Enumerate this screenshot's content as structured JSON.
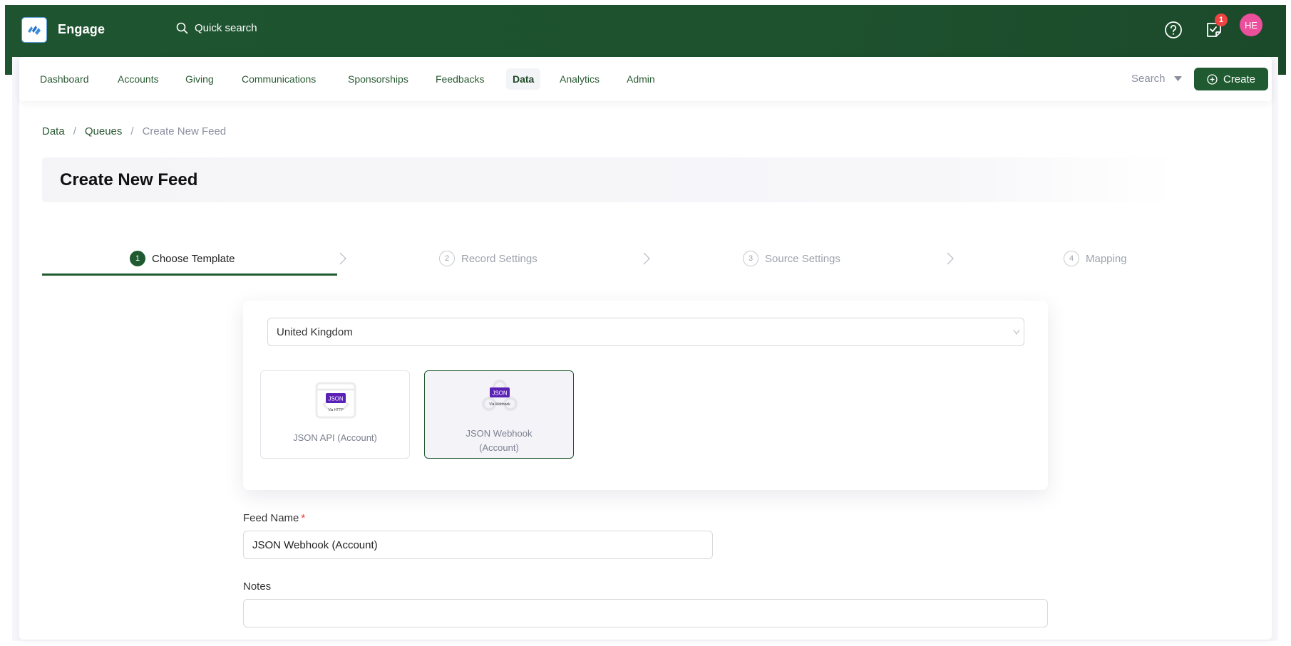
{
  "header": {
    "brand": "Engage",
    "quick_search_label": "Quick search",
    "notification_count": "1",
    "avatar_initials": "HE"
  },
  "nav": {
    "items": [
      {
        "label": "Dashboard",
        "active": false
      },
      {
        "label": "Accounts",
        "active": false
      },
      {
        "label": "Giving",
        "active": false
      },
      {
        "label": "Communications",
        "active": false
      },
      {
        "label": "Sponsorships",
        "active": false
      },
      {
        "label": "Feedbacks",
        "active": false
      },
      {
        "label": "Data",
        "active": true
      },
      {
        "label": "Analytics",
        "active": false
      },
      {
        "label": "Admin",
        "active": false
      }
    ],
    "search_label": "Search",
    "create_label": "Create"
  },
  "breadcrumb": {
    "items": [
      "Data",
      "Queues",
      "Create New Feed"
    ],
    "separator": "/"
  },
  "page": {
    "title": "Create New Feed"
  },
  "steps": [
    {
      "number": "1",
      "label": "Choose Template",
      "active": true
    },
    {
      "number": "2",
      "label": "Record Settings",
      "active": false
    },
    {
      "number": "3",
      "label": "Source Settings",
      "active": false
    },
    {
      "number": "4",
      "label": "Mapping",
      "active": false
    }
  ],
  "template": {
    "country_selected": "United Kingdom",
    "tiles": [
      {
        "label": "JSON API (Account)",
        "badge": "JSON",
        "sub": "Via HTTP",
        "icon": "api-window-icon",
        "selected": false
      },
      {
        "label": "JSON Webhook (Account)",
        "label_line1": "JSON Webhook",
        "label_line2": "(Account)",
        "badge": "JSON",
        "sub": "Via Webhook",
        "icon": "webhook-icon",
        "selected": true
      }
    ]
  },
  "form": {
    "feed_name_label": "Feed Name",
    "required_mark": "*",
    "feed_name_value": "JSON Webhook (Account)",
    "notes_label": "Notes",
    "notes_value": ""
  },
  "colors": {
    "brand_green": "#1f5a30",
    "header_green": "#1f5430",
    "badge_red": "#ef4444",
    "avatar_pink": "#ec4f9c",
    "json_purple": "#5b21b6"
  }
}
